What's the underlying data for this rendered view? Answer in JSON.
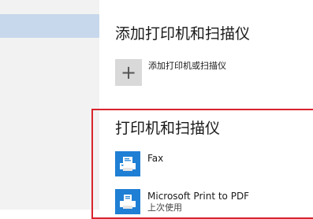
{
  "add_section": {
    "title": "添加打印机和扫描仪",
    "add_button_label": "添加打印机或扫描仪",
    "plus_symbol": "+"
  },
  "printers_section": {
    "title": "打印机和扫描仪",
    "devices": [
      {
        "name": "Fax",
        "status": "",
        "icon": "fax-printer-icon"
      },
      {
        "name": "Microsoft Print to PDF",
        "status": "上次使用",
        "icon": "pdf-printer-icon"
      }
    ]
  },
  "colors": {
    "sidebar_bg": "#f2f2f2",
    "sidebar_selected": "#c7d8ec",
    "icon_blue": "#1f7fd4",
    "highlight_red": "#d9232d",
    "add_box_bg": "#d9d9d9"
  }
}
